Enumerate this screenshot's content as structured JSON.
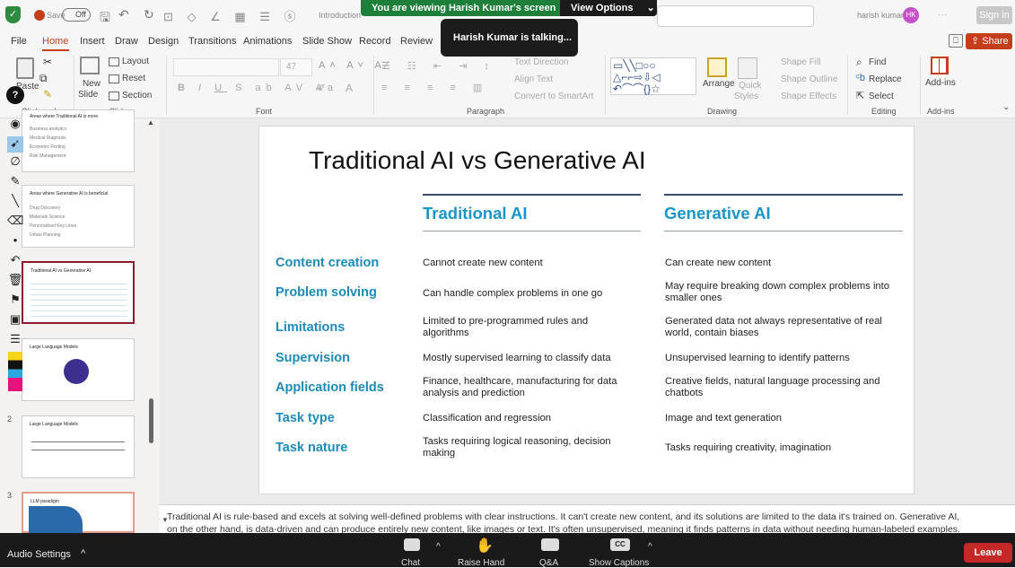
{
  "titlebar": {
    "autosave_label": "Save",
    "autosave_state": "Off",
    "doc_title": "Introduction",
    "user_name": "harish kumar",
    "user_initials": "HK",
    "sign_in": "Sign in",
    "more": "···"
  },
  "meeting_banner": {
    "text": "You are viewing Harish Kumar's screen",
    "view_options": "View Options",
    "talking": "Harish Kumar is talking..."
  },
  "menu": {
    "tabs": [
      "File",
      "Home",
      "Insert",
      "Draw",
      "Design",
      "Transitions",
      "Animations",
      "Slide Show",
      "Record",
      "Review"
    ],
    "share": "Share"
  },
  "ribbon": {
    "paste": "Paste",
    "new_slide_1": "New",
    "new_slide_2": "Slide",
    "layout": "Layout",
    "reset": "Reset",
    "section": "Section",
    "font_size": "47",
    "text_direction": "Text Direction",
    "align_text": "Align Text",
    "convert_smartart": "Convert to SmartArt",
    "arrange": "Arrange",
    "quick_styles_1": "Quick",
    "quick_styles_2": "Styles",
    "shape_fill": "Shape Fill",
    "shape_outline": "Shape Outline",
    "shape_effects": "Shape Effects",
    "find": "Find",
    "replace": "Replace",
    "select": "Select",
    "addins": "Add-ins",
    "groups": {
      "clipboard": "Clipboard",
      "slides": "Slides",
      "font": "Font",
      "paragraph": "Paragraph",
      "drawing": "Drawing",
      "editing": "Editing",
      "addins": "Add-ins"
    }
  },
  "thumbnails": [
    {
      "title": "Areas where Traditional AI is more",
      "lines": [
        "Business analytics",
        "Medical Diagnosis",
        "Economic Finding",
        "Risk Management"
      ]
    },
    {
      "title": "Areas where Generative AI is beneficial",
      "lines": [
        "Drug Discovery",
        "Materials Science",
        "Personalized Key Lines",
        "Urban Planning"
      ]
    },
    {
      "title": "Traditional AI vs Generative AI",
      "lines": []
    },
    {
      "title": "Large Language Models",
      "lines": []
    },
    {
      "title": "Large Language Models",
      "lines": []
    },
    {
      "title": "LLM paradigm",
      "lines": []
    }
  ],
  "thumb_numbers": [
    "2",
    "3"
  ],
  "slide": {
    "title": "Traditional AI vs Generative AI",
    "col1_header": "Traditional AI",
    "col2_header": "Generative AI",
    "rows": [
      {
        "label": "Content creation",
        "trad": "Cannot create new content",
        "gen": "Can create new content"
      },
      {
        "label": "Problem solving",
        "trad": "Can handle complex problems in one go",
        "gen": "May require breaking down complex problems into smaller ones"
      },
      {
        "label": "Limitations",
        "trad": "Limited to pre-programmed rules and algorithms",
        "gen": "Generated data not always representative of real world, contain biases"
      },
      {
        "label": "Supervision",
        "trad": "Mostly supervised learning to classify data",
        "gen": "Unsupervised learning to identify patterns"
      },
      {
        "label": "Application fields",
        "trad": "Finance, healthcare, manufacturing for data analysis and prediction",
        "gen": "Creative fields, natural language processing and chatbots"
      },
      {
        "label": "Task type",
        "trad": "Classification and regression",
        "gen": "Image and text generation"
      },
      {
        "label": "Task nature",
        "trad": "Tasks requiring logical reasoning, decision making",
        "gen": "Tasks requiring creativity, imagination"
      }
    ]
  },
  "notes": {
    "line1": "Traditional AI is rule-based and excels at solving well-defined problems with clear instructions. It can't create new content, and its solutions are limited to the data it's trained on. Generative AI,",
    "line2": "on the other hand, is data-driven and can produce entirely new content, like images or text. It's often unsupervised, meaning it finds patterns in data without needing human-labeled examples."
  },
  "zoom": {
    "audio_settings": "Audio Settings",
    "chat": "Chat",
    "raise_hand": "Raise Hand",
    "qa": "Q&A",
    "show_captions": "Show Captions",
    "cc": "CC",
    "leave": "Leave"
  },
  "colors": {
    "accent": "#c43e1c",
    "zoom_green": "#1e7f3a",
    "label_blue": "#1e8ab8",
    "header_blue": "#1a95c8",
    "leave_red": "#c62828"
  }
}
